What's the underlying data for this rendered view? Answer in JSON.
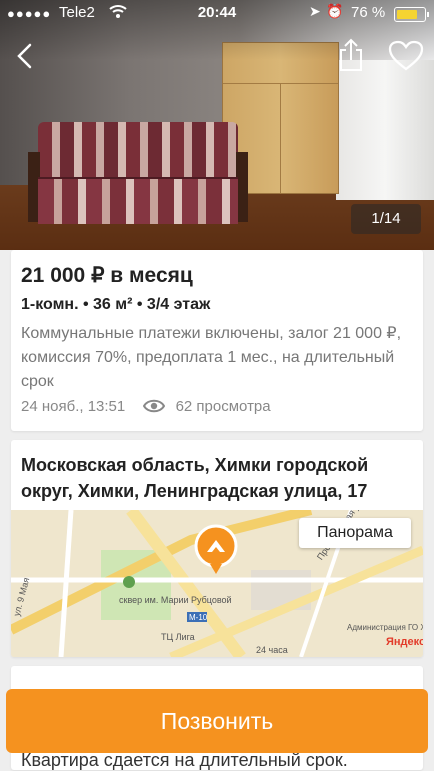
{
  "status_bar": {
    "signal": "●●●●●",
    "carrier": "Tele2",
    "time": "20:44",
    "battery": "76 %",
    "battery_level": 0.76,
    "battery_color": "#f5d432"
  },
  "photo": {
    "counter": "1/14",
    "back_icon": "chevron-left-icon",
    "share_icon": "share-icon",
    "favorite_icon": "heart-icon"
  },
  "listing": {
    "price": "21 000 ₽ в месяц",
    "specs": "1-комн. • 36 м² • 3/4 этаж",
    "description": "Коммунальные платежи включены, залог 21 000 ₽, комиссия 70%, предоплата 1 мес., на длительный срок",
    "date": "24 нояб., 13:51",
    "views": "62 просмотра"
  },
  "location": {
    "address": "Московская область, Химки городской округ, Химки, Ленинградская улица, 17",
    "panorama_label": "Панорама",
    "map_labels": {
      "street1": "ул. 9 Мая",
      "park": "сквер им. Марии Рубцовой",
      "road": "М-10",
      "mall": "ТЦ Лига",
      "hours": "24 часа",
      "admin": "Администрация ГО Химки",
      "street2": "Пролетарская ул.",
      "brand": "Яндекс"
    }
  },
  "next_section": {
    "text": "Квартира сдается на длительный срок."
  },
  "call_button": {
    "label": "Позвонить",
    "color": "#f5921f"
  }
}
